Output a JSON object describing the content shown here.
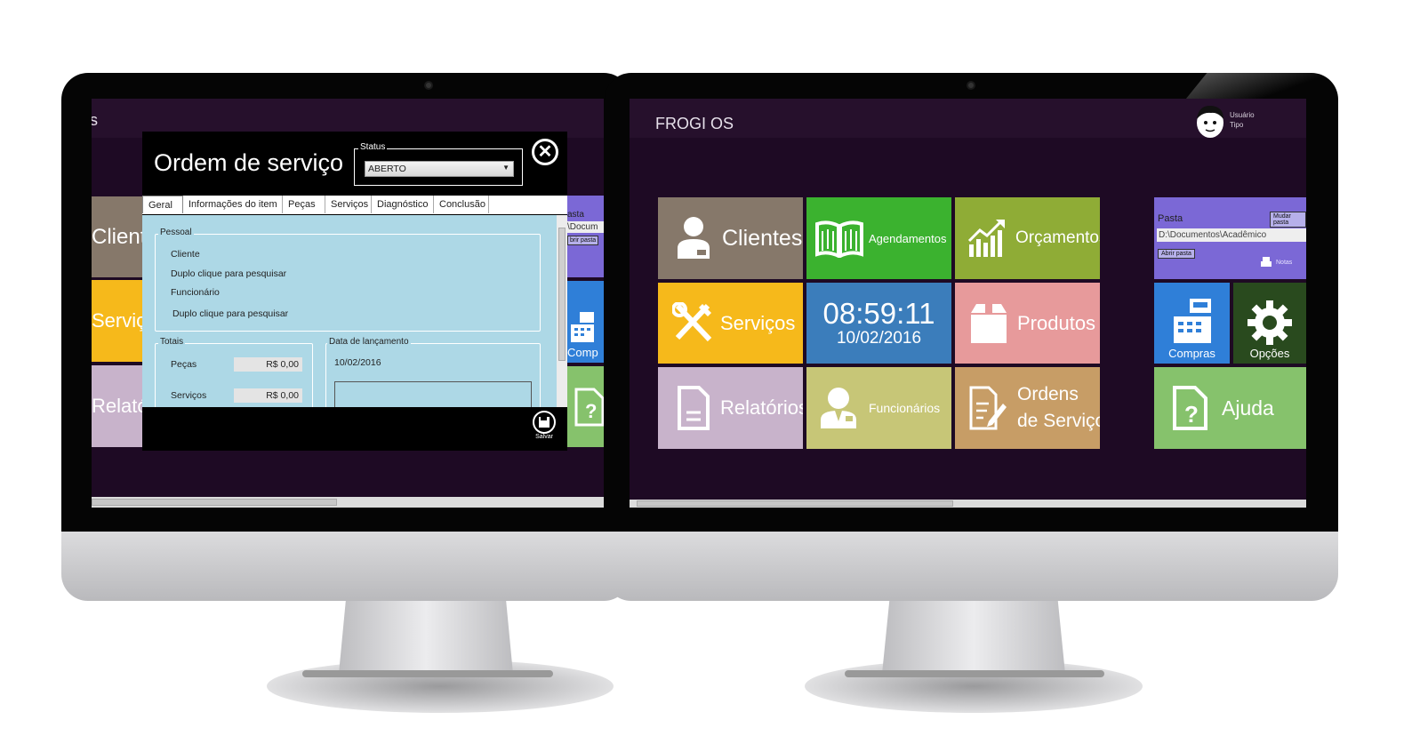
{
  "left_app": {
    "title_fragment": "s",
    "dialog": {
      "title": "Ordem de serviço",
      "status_label": "Status",
      "status_value": "ABERTO",
      "tabs": [
        "Geral",
        "Informações do item",
        "Peças",
        "Serviços",
        "Diagnóstico",
        "Conclusão"
      ],
      "section_pessoal": "Pessoal",
      "cliente_label": "Cliente",
      "cliente_hint": "Duplo clique para pesquisar",
      "funcionario_label": "Funcionário",
      "funcionario_hint": "Duplo clique para pesquisar",
      "section_totais": "Totais",
      "pecas_label": "Peças",
      "pecas_value": "R$ 0,00",
      "servicos_label": "Serviços",
      "servicos_value": "R$ 0,00",
      "section_data": "Data de lançamento",
      "data_value": "10/02/2016",
      "save_label": "Salvar"
    },
    "bg_tiles": {
      "clientes": "Client",
      "servicos": "Serviço",
      "relatorios": "Relatór",
      "pasta": "asta",
      "pasta_path": "\\Docum",
      "abrir": "brir pasta",
      "compras": "Comp"
    }
  },
  "right_app": {
    "title": "FROGI OS",
    "user": {
      "name": "Usuário",
      "type": "Tipo"
    },
    "tiles": {
      "clientes": "Clientes",
      "agendamentos": "Agendamentos",
      "orcamentos": "Orçamentos",
      "servicos": "Serviços",
      "clock_time": "08:59:11",
      "clock_date": "10/02/2016",
      "produtos": "Produtos",
      "relatorios": "Relatórios",
      "funcionarios": "Funcionários",
      "ordens_line1": "Ordens",
      "ordens_line2": "de Serviço",
      "compras": "Compras",
      "opcoes": "Opções",
      "ajuda": "Ajuda"
    },
    "pasta": {
      "label": "Pasta",
      "change_button": "Mudar pasta",
      "path": "D:\\Documentos\\Acadêmico",
      "open_button": "Abrir pasta",
      "notes": "Notas"
    }
  },
  "colors": {
    "screen_bg": "#1e0a24",
    "clientes": "#86786a",
    "agendamentos": "#3bb22f",
    "orcamentos": "#8fac36",
    "servicos": "#f6b91b",
    "clock": "#3b7dbb",
    "produtos": "#e79a9b",
    "relatorios": "#c8b3cb",
    "funcionarios": "#c7c677",
    "ordens": "#c79d66",
    "pasta": "#7b68d6",
    "compras": "#2f7fd8",
    "opcoes": "#294a1e",
    "ajuda": "#86c26c",
    "dialog_pane": "#add8e6"
  }
}
